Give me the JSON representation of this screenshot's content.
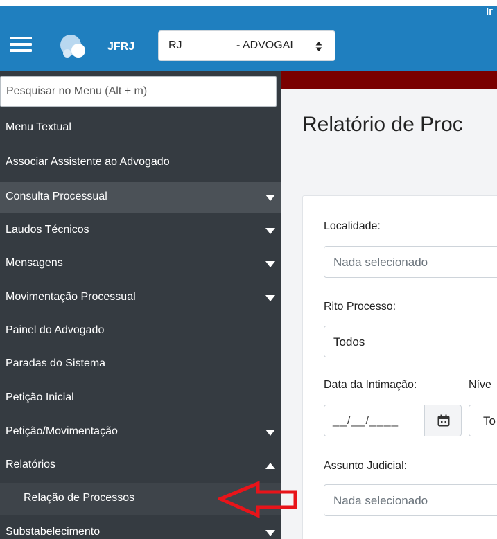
{
  "header": {
    "corner_text": "Ir",
    "brand": "JFRJ",
    "org_select": {
      "part1": "RJ",
      "part2": "- ADVOGAI"
    }
  },
  "sidebar": {
    "search_placeholder": "Pesquisar no Menu (Alt + m)",
    "items": [
      {
        "label": "Menu Textual"
      },
      {
        "label": "Associar Assistente ao Advogado"
      },
      {
        "label": "Consulta Processual"
      },
      {
        "label": "Laudos Técnicos"
      },
      {
        "label": "Mensagens"
      },
      {
        "label": "Movimentação Processual"
      },
      {
        "label": "Painel do Advogado"
      },
      {
        "label": "Paradas do Sistema"
      },
      {
        "label": "Petição Inicial"
      },
      {
        "label": "Petição/Movimentação"
      },
      {
        "label": "Relatórios"
      },
      {
        "label": "Relação de Processos"
      },
      {
        "label": "Substabelecimento"
      }
    ]
  },
  "main": {
    "title": "Relatório de Proc",
    "form": {
      "localidade_label": "Localidade:",
      "localidade_placeholder": "Nada selecionado",
      "rito_label": "Rito Processo:",
      "rito_value": "Todos",
      "data_intimacao_label": "Data da Intimação:",
      "date_mask": "__/__/____",
      "nivel_label": "Níve",
      "nivel_value": "To",
      "assunto_label": "Assunto Judicial:",
      "assunto_placeholder": "Nada selecionado"
    }
  },
  "colors": {
    "header": "#1f7fbf",
    "sidebar": "#353b41",
    "sidebar_active": "#4b5157",
    "accent_band": "#7a0000",
    "annotation_arrow": "#e8141a"
  }
}
